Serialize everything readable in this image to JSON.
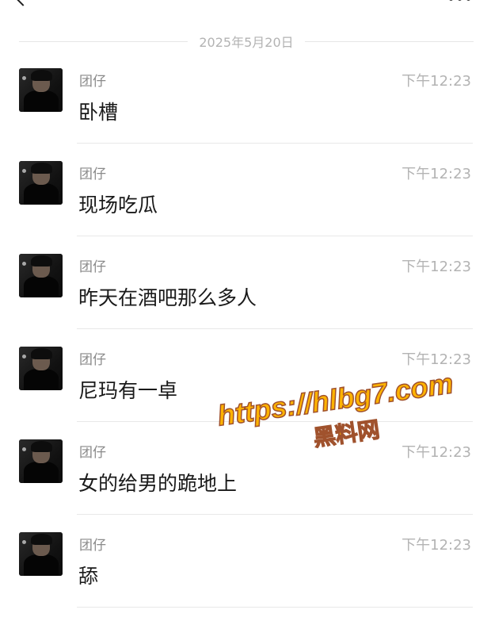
{
  "header": {
    "back_icon": "back-chevron-icon",
    "more_icon": "more-dots-icon"
  },
  "date_divider": "2025年5月20日",
  "messages": [
    {
      "sender": "团仔",
      "time": "下午12:23",
      "text": "卧槽"
    },
    {
      "sender": "团仔",
      "time": "下午12:23",
      "text": "现场吃瓜"
    },
    {
      "sender": "团仔",
      "time": "下午12:23",
      "text": "昨天在酒吧那么多人"
    },
    {
      "sender": "团仔",
      "time": "下午12:23",
      "text": "尼玛有一卓"
    },
    {
      "sender": "团仔",
      "time": "下午12:23",
      "text": "女的给男的跪地上"
    },
    {
      "sender": "团仔",
      "time": "下午12:23",
      "text": "舔"
    }
  ],
  "watermark": {
    "url": "https://hlbg7.com",
    "name": "黑料网",
    "color": "#ffb300",
    "stroke_color": "#a0522d"
  }
}
